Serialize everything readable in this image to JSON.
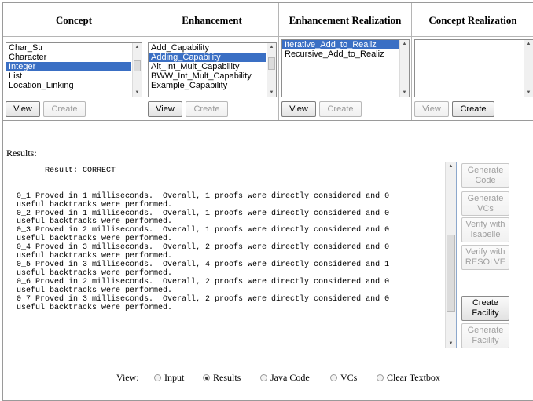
{
  "columns": [
    {
      "header": "Concept",
      "items": [
        "Char_Str",
        "Character",
        "Integer",
        "List",
        "Location_Linking"
      ],
      "selected_index": 2,
      "view_label": "View",
      "create_label": "Create"
    },
    {
      "header": "Enhancement",
      "items": [
        "Add_Capability",
        "Adding_Capability",
        "Alt_Int_Mult_Capability",
        "BWW_Int_Mult_Capability",
        "Example_Capability"
      ],
      "selected_index": 1,
      "view_label": "View",
      "create_label": "Create"
    },
    {
      "header": "Enhancement Realization",
      "items": [
        "Iterative_Add_to_Realiz",
        "Recursive_Add_to_Realiz"
      ],
      "selected_index": 0,
      "view_label": "View",
      "create_label": "Create"
    },
    {
      "header": "Concept Realization",
      "items": [],
      "selected_index": -1,
      "view_label": "View",
      "create_label": "Create"
    }
  ],
  "results": {
    "label": "Results:",
    "text": "      Result: CORRECT\n\n\n0_1 Proved in 1 milliseconds.  Overall, 1 proofs were directly considered and 0\nuseful backtracks were performed.\n0_2 Proved in 1 milliseconds.  Overall, 1 proofs were directly considered and 0\nuseful backtracks were performed.\n0_3 Proved in 2 milliseconds.  Overall, 1 proofs were directly considered and 0\nuseful backtracks were performed.\n0_4 Proved in 3 milliseconds.  Overall, 2 proofs were directly considered and 0\nuseful backtracks were performed.\n0_5 Proved in 3 milliseconds.  Overall, 4 proofs were directly considered and 1\nuseful backtracks were performed.\n0_6 Proved in 2 milliseconds.  Overall, 2 proofs were directly considered and 0\nuseful backtracks were performed.\n0_7 Proved in 3 milliseconds.  Overall, 2 proofs were directly considered and 0\nuseful backtracks were performed."
  },
  "side_buttons": {
    "generate_code": "Generate Code",
    "generate_vcs": "Generate VCs",
    "verify_isabelle": "Verify with Isabelle",
    "verify_resolve": "Verify with RESOLVE",
    "create_facility": "Create Facility",
    "generate_facility": "Generate Facility"
  },
  "view_options": {
    "label": "View:",
    "input": "Input",
    "results": "Results",
    "java_code": "Java Code",
    "vcs": "VCs",
    "clear_textbox": "Clear Textbox",
    "selected": "Results"
  }
}
